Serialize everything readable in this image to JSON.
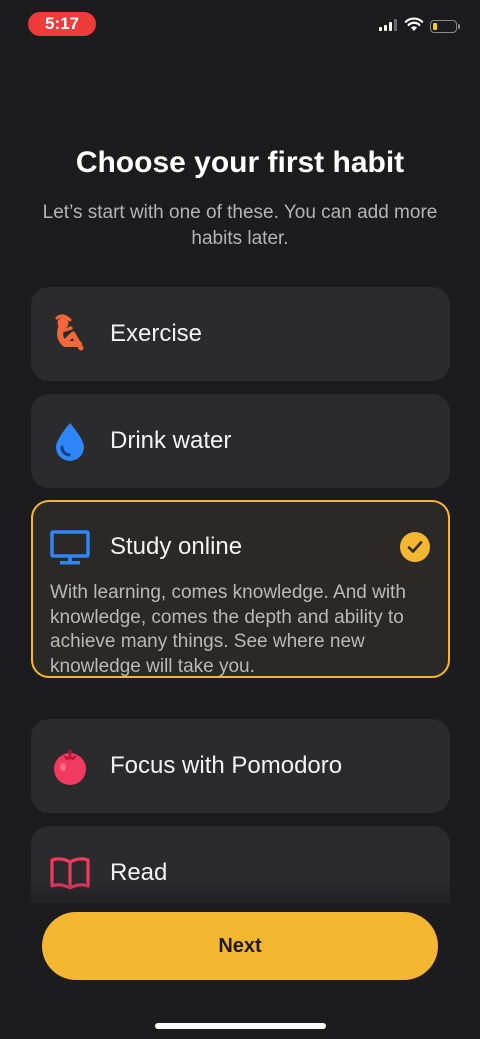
{
  "status_bar": {
    "time": "5:17",
    "icons": [
      "cellular-signal-icon",
      "wifi-icon",
      "battery-icon"
    ],
    "battery_color": "#f5d000"
  },
  "header": {
    "title": "Choose your first habit",
    "subtitle": "Let’s start with one of these. You can add more habits later."
  },
  "habits": [
    {
      "label": "Exercise",
      "icon": "exercise-icon",
      "color": "#f4673a",
      "selected": false
    },
    {
      "label": "Drink water",
      "icon": "water-drop-icon",
      "color": "#2f86f6",
      "selected": false
    },
    {
      "label": "Study online",
      "icon": "monitor-icon",
      "color": "#2f86f6",
      "selected": true,
      "description": "With learning, comes knowledge. And with knowledge, comes the depth and ability to achieve many things. See where new knowledge will take you."
    },
    {
      "label": "Focus with Pomodoro",
      "icon": "tomato-icon",
      "color": "#f03a5f",
      "selected": false
    },
    {
      "label": "Read",
      "icon": "book-icon",
      "color": "#f03a5f",
      "selected": false
    }
  ],
  "next_button": {
    "label": "Next"
  },
  "colors": {
    "accent": "#f5b731",
    "background": "#1c1b1d",
    "card": "#2b2a2d"
  }
}
